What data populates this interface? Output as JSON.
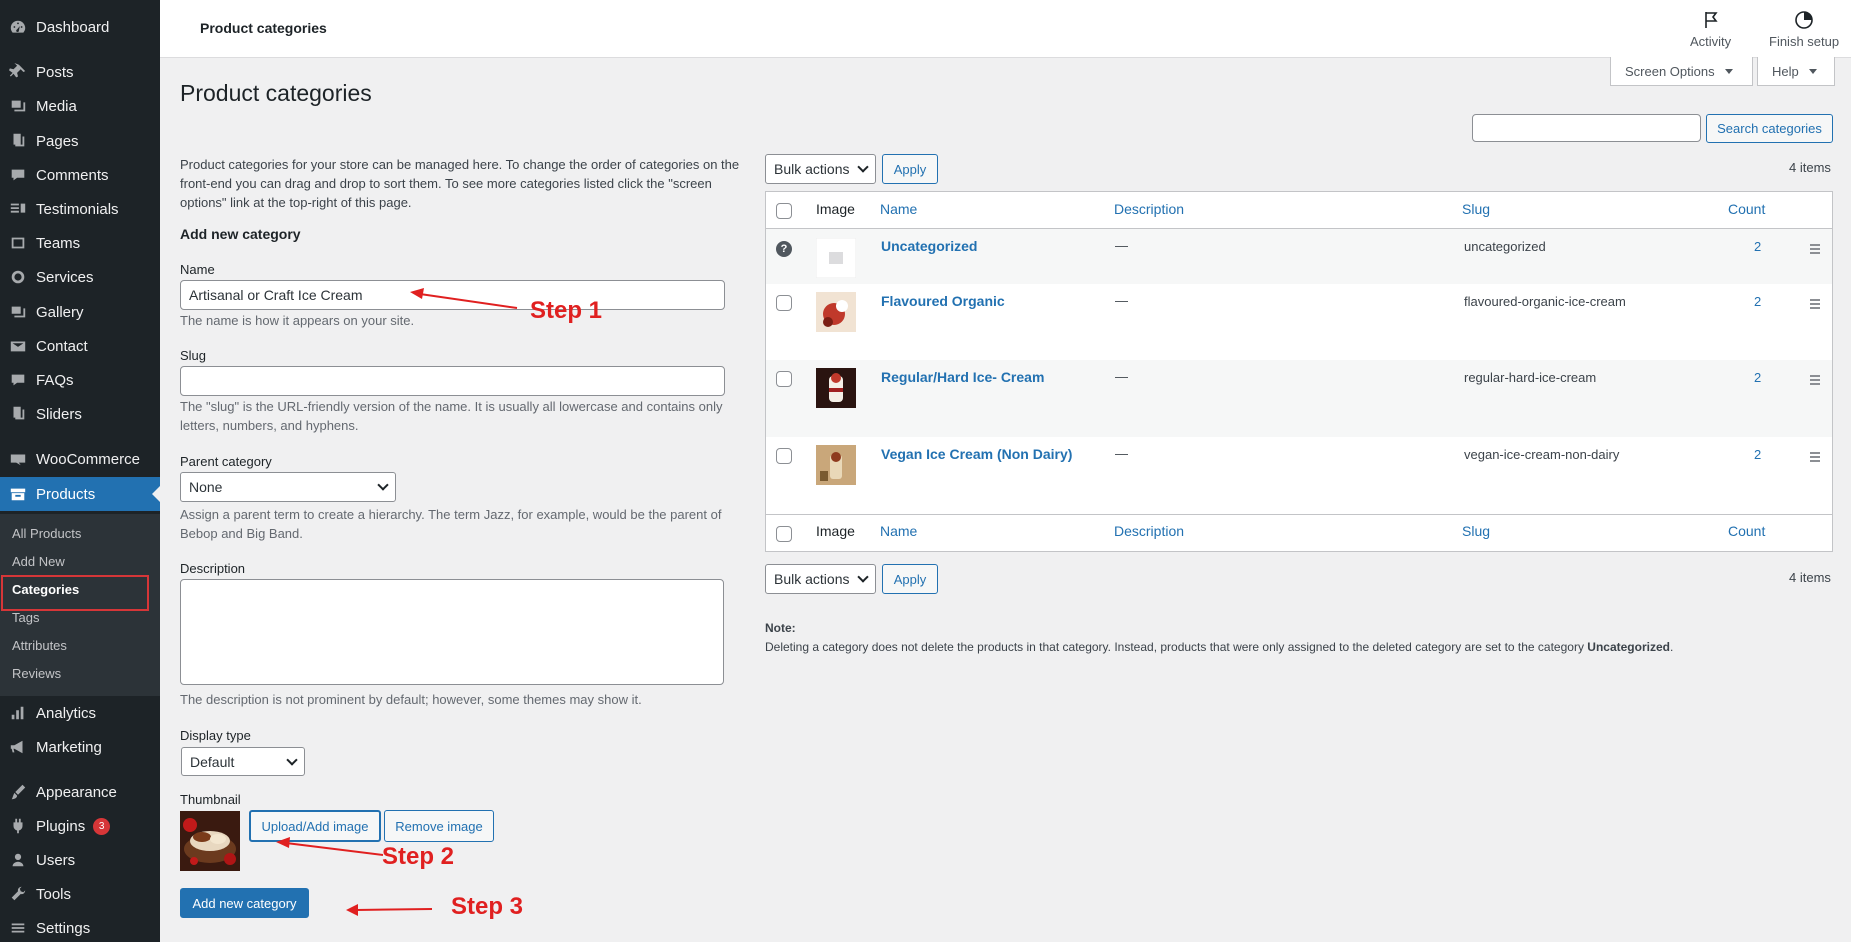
{
  "sidebar": {
    "items": [
      {
        "label": "Dashboard",
        "icon": "dashboard-icon"
      },
      {
        "label": "Posts",
        "icon": "pushpin-icon"
      },
      {
        "label": "Media",
        "icon": "media-icon"
      },
      {
        "label": "Pages",
        "icon": "pages-icon"
      },
      {
        "label": "Comments",
        "icon": "comment-icon"
      },
      {
        "label": "Testimonials",
        "icon": "testimonial-icon"
      },
      {
        "label": "Teams",
        "icon": "teams-icon"
      },
      {
        "label": "Services",
        "icon": "services-icon"
      },
      {
        "label": "Gallery",
        "icon": "gallery-icon"
      },
      {
        "label": "Contact",
        "icon": "envelope-icon"
      },
      {
        "label": "FAQs",
        "icon": "faq-icon"
      },
      {
        "label": "Sliders",
        "icon": "slider-icon"
      },
      {
        "label": "WooCommerce",
        "icon": "woo-icon"
      },
      {
        "label": "Products",
        "icon": "archive-icon"
      },
      {
        "label": "Analytics",
        "icon": "analytics-icon"
      },
      {
        "label": "Marketing",
        "icon": "megaphone-icon"
      },
      {
        "label": "Appearance",
        "icon": "brush-icon"
      },
      {
        "label": "Plugins",
        "icon": "plugin-icon",
        "badge": "3"
      },
      {
        "label": "Users",
        "icon": "users-icon"
      },
      {
        "label": "Tools",
        "icon": "wrench-icon"
      },
      {
        "label": "Settings",
        "icon": "settings-icon"
      }
    ],
    "submenu": [
      "All Products",
      "Add New",
      "Categories",
      "Tags",
      "Attributes",
      "Reviews"
    ]
  },
  "header": {
    "title": "Product categories",
    "activity": "Activity",
    "finish_setup": "Finish setup",
    "screen_options": "Screen Options",
    "help": "Help"
  },
  "page": {
    "title": "Product categories",
    "intro": "Product categories for your store can be managed here. To change the order of categories on the front-end you can drag and drop to sort them. To see more categories listed click the \"screen options\" link at the top-right of this page."
  },
  "form": {
    "heading": "Add new category",
    "name_label": "Name",
    "name_value": "Artisanal or Craft Ice Cream",
    "name_help": "The name is how it appears on your site.",
    "slug_label": "Slug",
    "slug_value": "",
    "slug_help": "The \"slug\" is the URL-friendly version of the name. It is usually all lowercase and contains only letters, numbers, and hyphens.",
    "parent_label": "Parent category",
    "parent_value": "None",
    "parent_help": "Assign a parent term to create a hierarchy. The term Jazz, for example, would be the parent of Bebop and Big Band.",
    "description_label": "Description",
    "description_value": "",
    "description_help": "The description is not prominent by default; however, some themes may show it.",
    "display_label": "Display type",
    "display_value": "Default",
    "thumbnail_label": "Thumbnail",
    "upload_button": "Upload/Add image",
    "remove_button": "Remove image",
    "submit_button": "Add new category"
  },
  "annotations": {
    "step1": "Step 1",
    "step2": "Step 2",
    "step3": "Step 3",
    "color": "#e02020"
  },
  "search": {
    "button": "Search categories",
    "value": ""
  },
  "bulk": {
    "label": "Bulk actions",
    "apply": "Apply",
    "items_count": "4 items"
  },
  "table": {
    "columns": {
      "image": "Image",
      "name": "Name",
      "description": "Description",
      "slug": "Slug",
      "count": "Count"
    },
    "rows": [
      {
        "name": "Uncategorized",
        "description": "—",
        "slug": "uncategorized",
        "count": "2"
      },
      {
        "name": "Flavoured Organic",
        "description": "—",
        "slug": "flavoured-organic-ice-cream",
        "count": "2"
      },
      {
        "name": "Regular/Hard Ice- Cream",
        "description": "—",
        "slug": "regular-hard-ice-cream",
        "count": "2"
      },
      {
        "name": "Vegan Ice Cream (Non Dairy)",
        "description": "—",
        "slug": "vegan-ice-cream-non-dairy",
        "count": "2"
      }
    ]
  },
  "note": {
    "label": "Note:",
    "text_before": "Deleting a category does not delete the products in that category. Instead, products that were only assigned to the deleted category are set to the category ",
    "text_bold": "Uncategorized",
    "text_after": "."
  },
  "colors": {
    "accent": "#2271b1",
    "sidebar_bg": "#1d2327",
    "highlight": "#d63638"
  }
}
